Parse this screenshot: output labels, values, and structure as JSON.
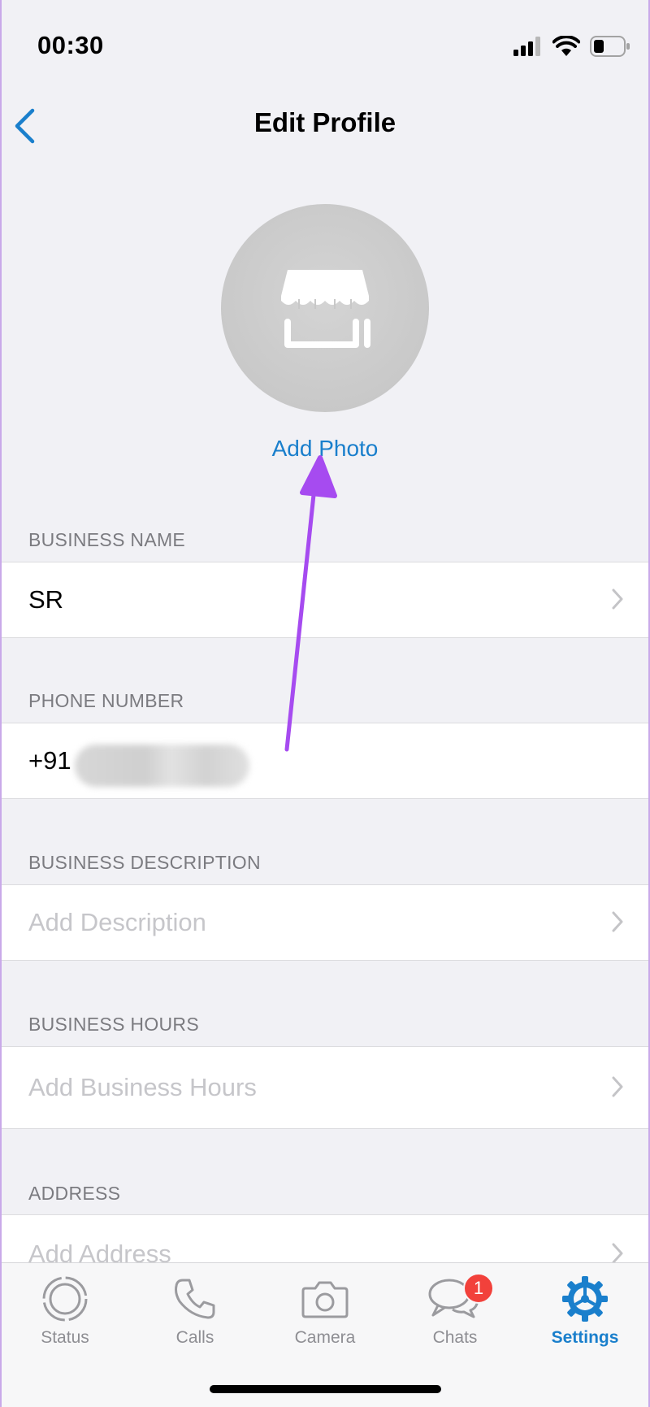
{
  "status_bar": {
    "time": "00:30"
  },
  "nav": {
    "title": "Edit Profile"
  },
  "avatar": {
    "action_label": "Add Photo"
  },
  "sections": {
    "business_name": {
      "header": "BUSINESS NAME",
      "value": "SR"
    },
    "phone_number": {
      "header": "PHONE NUMBER",
      "value": "+91"
    },
    "business_description": {
      "header": "BUSINESS DESCRIPTION",
      "placeholder": "Add Description"
    },
    "business_hours": {
      "header": "BUSINESS HOURS",
      "placeholder": "Add Business Hours"
    },
    "address": {
      "header": "ADDRESS",
      "placeholder": "Add Address"
    }
  },
  "tab_bar": {
    "tabs": [
      {
        "label": "Status",
        "icon": "status-icon"
      },
      {
        "label": "Calls",
        "icon": "phone-icon"
      },
      {
        "label": "Camera",
        "icon": "camera-icon"
      },
      {
        "label": "Chats",
        "icon": "chat-bubbles-icon",
        "badge": "1"
      },
      {
        "label": "Settings",
        "icon": "gear-icon",
        "active": true
      }
    ]
  },
  "colors": {
    "accent": "#1a7fcc",
    "annotation_arrow": "#a64bf0",
    "badge": "#f2413b"
  }
}
